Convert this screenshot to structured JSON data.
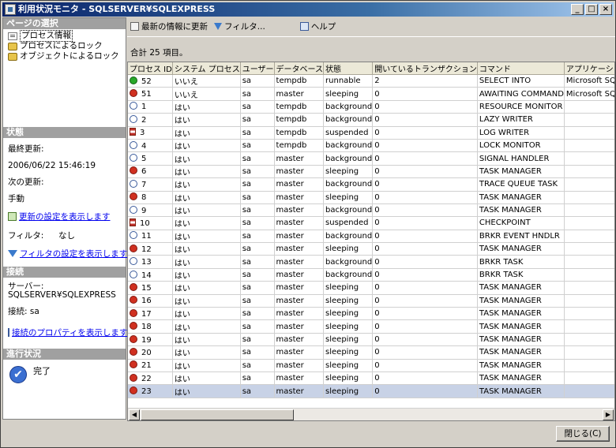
{
  "window": {
    "title": "利用状況モニタ - SQLSERVER¥SQLEXPRESS",
    "buttons": {
      "minimize": "_",
      "maximize": "□",
      "close": "×"
    }
  },
  "sidebar": {
    "page_select_header": "ページの選択",
    "items": [
      {
        "label": "プロセス情報",
        "icon": "process-info-icon",
        "selected": true
      },
      {
        "label": "プロセスによるロック",
        "icon": "lock-icon",
        "selected": false
      },
      {
        "label": "オブジェクトによるロック",
        "icon": "lock-icon",
        "selected": false
      }
    ],
    "status_header": "状態",
    "last_update_label": "最終更新:",
    "last_update_value": "2006/06/22 15:46:19",
    "next_update_label": "次の更新:",
    "next_update_value": "手動",
    "refresh_settings_link": "更新の設定を表示します",
    "filter_label": "フィルタ:",
    "filter_value": "なし",
    "filter_settings_link": "フィルタの設定を表示します",
    "connection_header": "接続",
    "server_label": "サーバー:",
    "server_value": "SQLSERVER¥SQLEXPRESS",
    "conn_line": "接続: sa",
    "conn_props_link": "接続のプロパティを表示します",
    "progress_header": "進行状況",
    "progress_value": "完了"
  },
  "toolbar": {
    "refresh": "最新の情報に更新",
    "filter": "フィルタ...",
    "help": "ヘルプ"
  },
  "summary": "合計 25 項目。",
  "columns": [
    "プロセス ID",
    "システム プロセス",
    "ユーザー",
    "データベース",
    "状態",
    "開いているトランザクション",
    "コマンド",
    "アプリケーション"
  ],
  "rows": [
    [
      "52",
      "いいえ",
      "sa",
      "tempdb",
      "runnable",
      "2",
      "SELECT INTO",
      "Microsoft SQL"
    ],
    [
      "51",
      "いいえ",
      "sa",
      "master",
      "sleeping",
      "0",
      "AWAITING COMMAND",
      "Microsoft SQL"
    ],
    [
      "1",
      "はい",
      "sa",
      "tempdb",
      "background",
      "0",
      "RESOURCE MONITOR",
      ""
    ],
    [
      "2",
      "はい",
      "sa",
      "tempdb",
      "background",
      "0",
      "LAZY WRITER",
      ""
    ],
    [
      "3",
      "はい",
      "sa",
      "tempdb",
      "suspended",
      "0",
      "LOG WRITER",
      ""
    ],
    [
      "4",
      "はい",
      "sa",
      "tempdb",
      "background",
      "0",
      "LOCK MONITOR",
      ""
    ],
    [
      "5",
      "はい",
      "sa",
      "master",
      "background",
      "0",
      "SIGNAL HANDLER",
      ""
    ],
    [
      "6",
      "はい",
      "sa",
      "master",
      "sleeping",
      "0",
      "TASK MANAGER",
      ""
    ],
    [
      "7",
      "はい",
      "sa",
      "master",
      "background",
      "0",
      "TRACE QUEUE TASK",
      ""
    ],
    [
      "8",
      "はい",
      "sa",
      "master",
      "sleeping",
      "0",
      "TASK MANAGER",
      ""
    ],
    [
      "9",
      "はい",
      "sa",
      "master",
      "background",
      "0",
      "TASK MANAGER",
      ""
    ],
    [
      "10",
      "はい",
      "sa",
      "master",
      "suspended",
      "0",
      "CHECKPOINT",
      ""
    ],
    [
      "11",
      "はい",
      "sa",
      "master",
      "background",
      "0",
      "BRKR EVENT HNDLR",
      ""
    ],
    [
      "12",
      "はい",
      "sa",
      "master",
      "sleeping",
      "0",
      "TASK MANAGER",
      ""
    ],
    [
      "13",
      "はい",
      "sa",
      "master",
      "background",
      "0",
      "BRKR TASK",
      ""
    ],
    [
      "14",
      "はい",
      "sa",
      "master",
      "background",
      "0",
      "BRKR TASK",
      ""
    ],
    [
      "15",
      "はい",
      "sa",
      "master",
      "sleeping",
      "0",
      "TASK MANAGER",
      ""
    ],
    [
      "16",
      "はい",
      "sa",
      "master",
      "sleeping",
      "0",
      "TASK MANAGER",
      ""
    ],
    [
      "17",
      "はい",
      "sa",
      "master",
      "sleeping",
      "0",
      "TASK MANAGER",
      ""
    ],
    [
      "18",
      "はい",
      "sa",
      "master",
      "sleeping",
      "0",
      "TASK MANAGER",
      ""
    ],
    [
      "19",
      "はい",
      "sa",
      "master",
      "sleeping",
      "0",
      "TASK MANAGER",
      ""
    ],
    [
      "20",
      "はい",
      "sa",
      "master",
      "sleeping",
      "0",
      "TASK MANAGER",
      ""
    ],
    [
      "21",
      "はい",
      "sa",
      "master",
      "sleeping",
      "0",
      "TASK MANAGER",
      ""
    ],
    [
      "22",
      "はい",
      "sa",
      "master",
      "sleeping",
      "0",
      "TASK MANAGER",
      ""
    ],
    [
      "23",
      "はい",
      "sa",
      "master",
      "sleeping",
      "0",
      "TASK MANAGER",
      ""
    ]
  ],
  "selected_row_index": 24,
  "close_button": "閉じる(C)"
}
